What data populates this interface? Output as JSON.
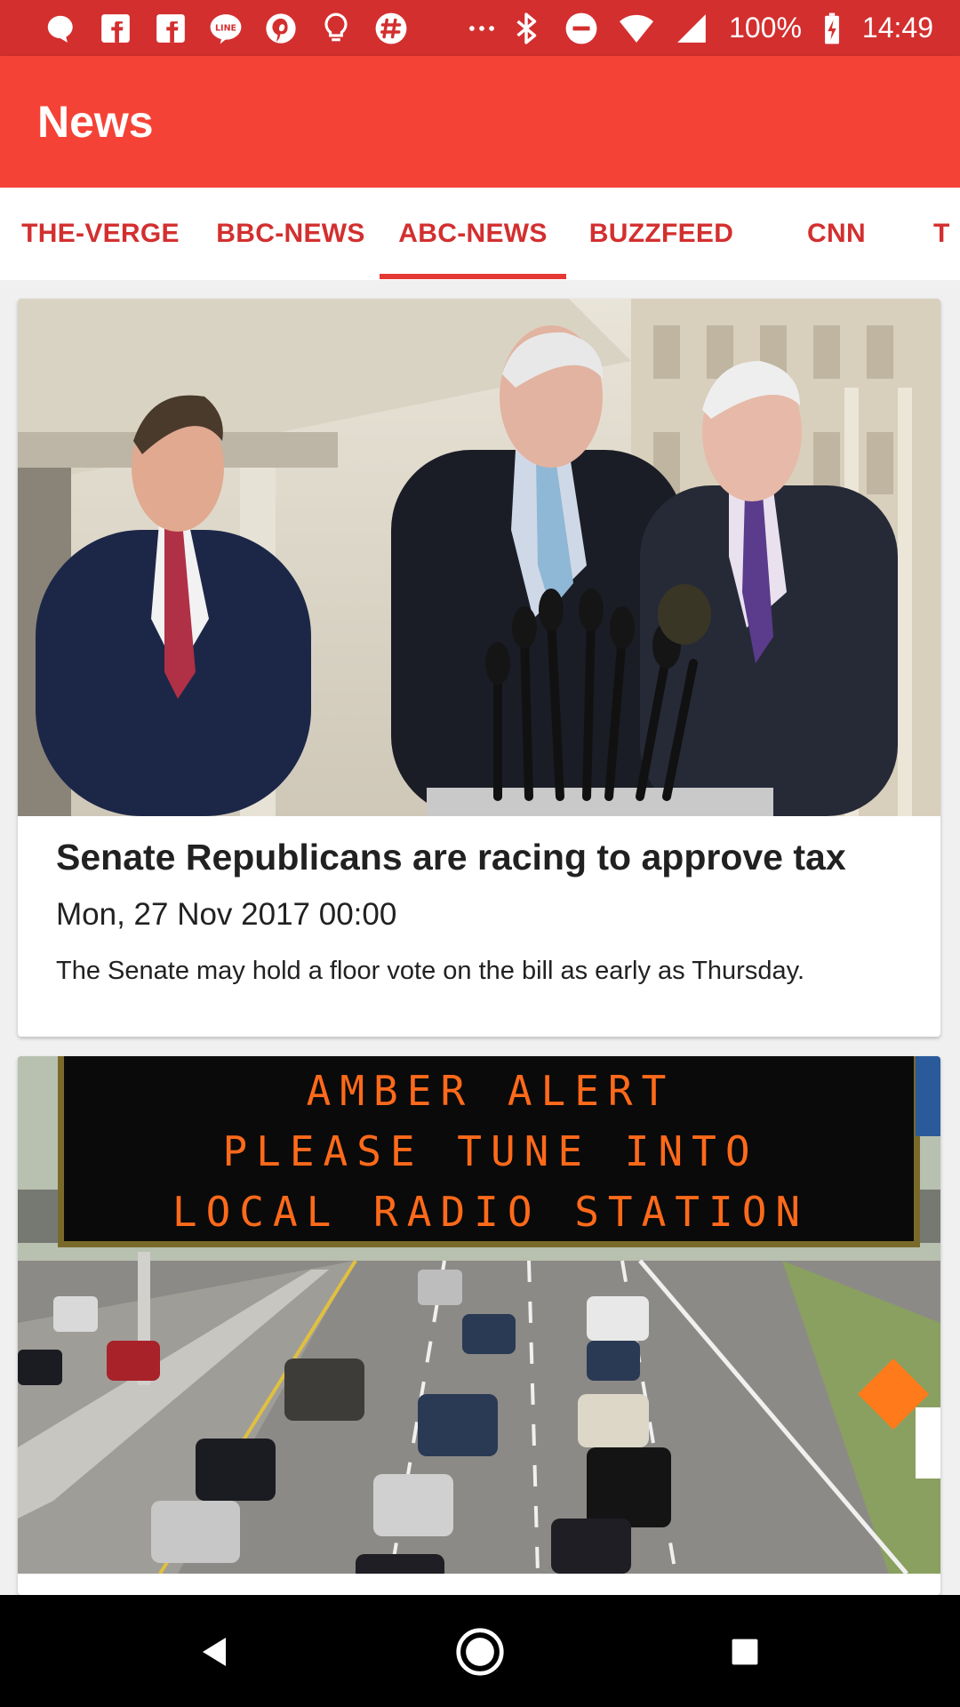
{
  "status_bar": {
    "battery": "100%",
    "time": "14:49",
    "icons": [
      "chat-bubble-icon",
      "facebook-icon",
      "facebook-icon",
      "line-icon",
      "pinterest-icon",
      "lightbulb-icon",
      "slack-icon",
      "more-dots-icon",
      "bluetooth-icon",
      "do-not-disturb-icon",
      "wifi-icon",
      "signal-icon",
      "battery-charging-icon"
    ]
  },
  "app_bar": {
    "title": "News"
  },
  "tabs": [
    {
      "label": "THE-VERGE"
    },
    {
      "label": "BBC-NEWS"
    },
    {
      "label": "ABC-NEWS",
      "selected": true
    },
    {
      "label": "BUZZFEED"
    },
    {
      "label": "CNN"
    },
    {
      "label": "T"
    }
  ],
  "articles": [
    {
      "title": "Senate Republicans are racing to approve tax",
      "date": "Mon, 27 Nov 2017 00:00",
      "description": "The Senate may hold a floor vote on the bill as early as Thursday.",
      "image": "photo-senators-press-conference"
    },
    {
      "image": "photo-amber-alert-highway",
      "sign_lines": [
        "AMBER ALERT",
        "PLEASE TUNE INTO",
        "LOCAL RADIO STATION"
      ]
    }
  ],
  "colors": {
    "status_bar": "#d32f2f",
    "app_bar": "#f44336",
    "tab_text": "#d32f2f",
    "tab_indicator": "#e53935",
    "sign_text": "#ff6a1a"
  }
}
